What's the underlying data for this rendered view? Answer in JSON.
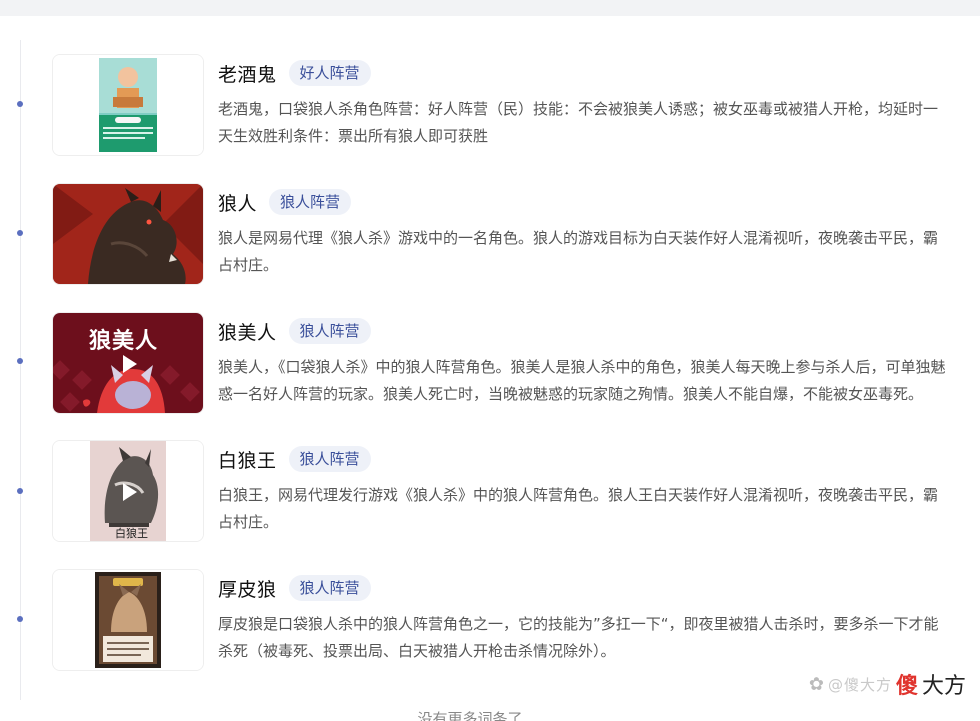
{
  "list": {
    "items": [
      {
        "title": "老酒鬼",
        "badge": "好人阵营",
        "description": "老酒鬼，口袋狼人杀角色阵营：好人阵营（民）技能：不会被狼美人诱惑；被女巫毒或被猎人开枪，均延时一天生效胜利条件：票出所有狼人即可获胜",
        "thumb_icon": "old-drunkard-card-image"
      },
      {
        "title": "狼人",
        "badge": "狼人阵营",
        "description": "狼人是网易代理《狼人杀》游戏中的一名角色。狼人的游戏目标为白天装作好人混淆视听，夜晚袭击平民，霸占村庄。",
        "thumb_icon": "werewolf-image"
      },
      {
        "title": "狼美人",
        "badge": "狼人阵营",
        "description": "狼美人，《口袋狼人杀》中的狼人阵营角色。狼美人是狼人杀中的角色，狼美人每天晚上参与杀人后，可单独魅惑一名好人阵营的玩家。狼美人死亡时，当晚被魅惑的玩家随之殉情。狼美人不能自爆，不能被女巫毒死。",
        "thumb_icon": "wolf-beauty-video-thumbnail",
        "thumb_text": "狼美人"
      },
      {
        "title": "白狼王",
        "badge": "狼人阵营",
        "description": "白狼王，网易代理发行游戏《狼人杀》中的狼人阵营角色。狼人王白天装作好人混淆视听，夜晚袭击平民，霸占村庄。",
        "thumb_icon": "white-wolf-king-video-thumbnail",
        "thumb_text": "白狼王"
      },
      {
        "title": "厚皮狼",
        "badge": "狼人阵营",
        "description": "厚皮狼是口袋狼人杀中的狼人阵营角色之一，它的技能为”多扛一下“，即夜里被猎人击杀时，要多杀一下才能杀死（被毒死、投票出局、白天被猎人开枪击杀情况除外）。",
        "thumb_icon": "thick-skin-wolf-card-image"
      }
    ]
  },
  "footer": {
    "no_more": "没有更多词条了"
  },
  "watermark": {
    "handle": "@傻大方",
    "brand_red": "傻",
    "brand_black": "大方"
  },
  "colors": {
    "accent": "#3a4f9a",
    "badge_bg": "#eef1f8",
    "timeline_dot": "#5b6fbf",
    "brand_red": "#e0342e"
  }
}
